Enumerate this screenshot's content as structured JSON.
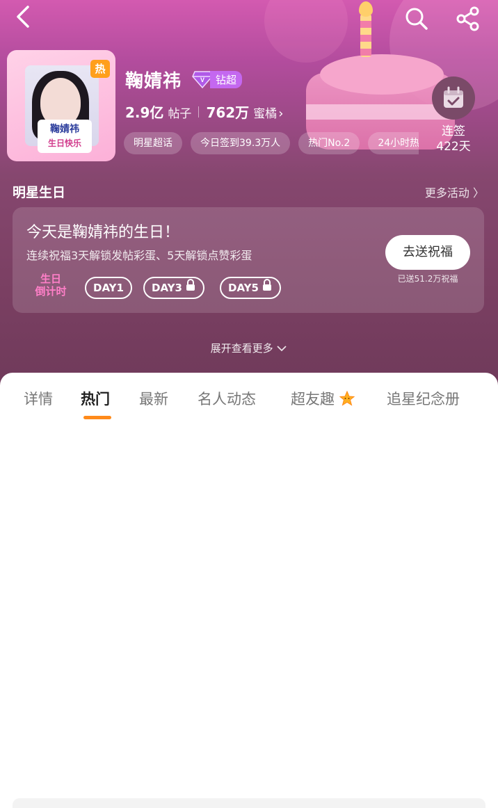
{
  "header": {
    "back_icon": "back-arrow-icon",
    "search_icon": "search-icon",
    "share_icon": "share-icon"
  },
  "profile": {
    "name": "鞠婧祎",
    "hot_badge": "热",
    "avatar_banner_line1": "鞠婧祎",
    "avatar_banner_line2": "生日快乐",
    "vip_label": "钻超",
    "posts_count": "2.9亿",
    "posts_unit": "帖子",
    "fans_count": "762万",
    "fans_unit": "蜜橘",
    "tags": [
      "明星超话",
      "今日签到39.3万人",
      "热门No.2",
      "24小时热"
    ]
  },
  "checkin": {
    "label": "连签",
    "days": "422天"
  },
  "birthday_section": {
    "title": "明星生日",
    "more_link": "更多活动 〉",
    "headline": "今天是鞠婧祎的生日！",
    "subtext": "连续祝福3天解锁发帖彩蛋、5天解锁点赞彩蛋",
    "bless_button": "去送祝福",
    "sent_text": "已送51.2万祝福",
    "countdown_line1": "生日",
    "countdown_line2": "倒计时",
    "days": [
      {
        "label": "DAY1",
        "locked": false
      },
      {
        "label": "DAY3",
        "locked": true
      },
      {
        "label": "DAY5",
        "locked": true
      }
    ]
  },
  "expand_text": "展开查看更多",
  "tabs": [
    "详情",
    "热门",
    "最新",
    "名人动态",
    "超友趣",
    "追星纪念册"
  ],
  "active_tab": "热门",
  "colors": {
    "accent": "#ff8a1a",
    "vip": "#c468f0",
    "hot": "#ff9f1c"
  }
}
